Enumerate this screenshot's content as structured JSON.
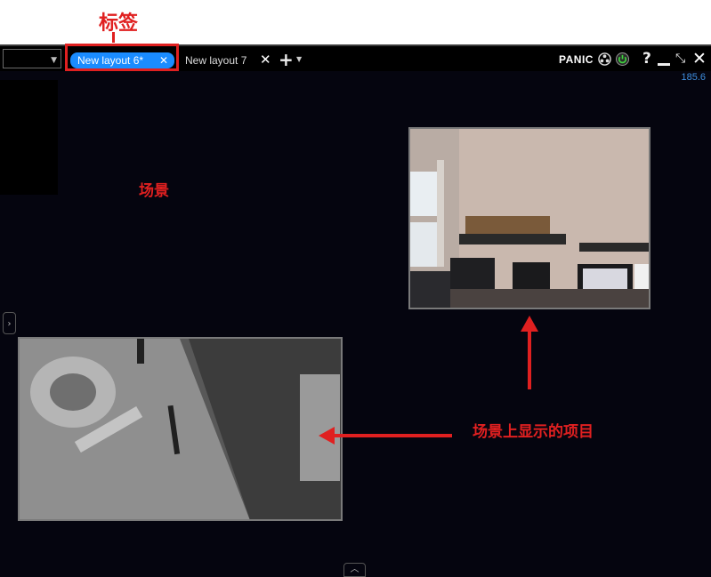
{
  "annotations": {
    "tab_label": "标签",
    "scene_label": "场景",
    "items_label": "场景上显示的项目"
  },
  "layout_selector": {
    "value": ""
  },
  "tabs": [
    {
      "label": "New layout 6*",
      "active": true
    },
    {
      "label": "New layout 7",
      "active": false
    }
  ],
  "toolbar": {
    "panic_label": "PANIC",
    "icons": [
      "reel-icon",
      "power-icon",
      "help-icon",
      "minimize-icon",
      "fullscreen-icon",
      "close-icon"
    ],
    "help_glyph": "?"
  },
  "status": {
    "fps": "185.6"
  },
  "colors": {
    "accent": "#1a8cff",
    "annotation": "#e02020",
    "scene_bg": "#05050f",
    "fps_text": "#3f8fe0"
  }
}
